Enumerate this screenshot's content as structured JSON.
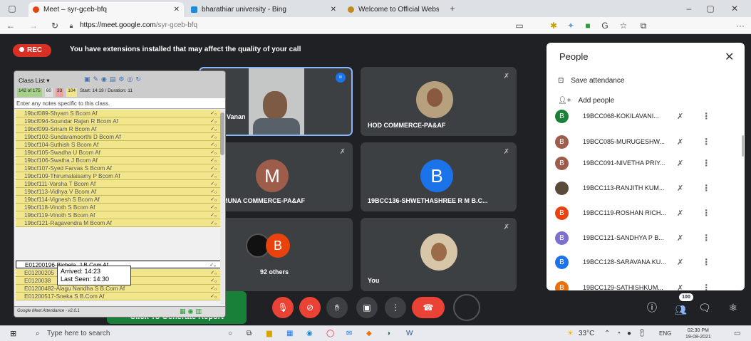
{
  "browser": {
    "tabs": [
      {
        "title": "Meet – syr-gceb-bfq"
      },
      {
        "title": "bharathiar university - Bing"
      },
      {
        "title": "Welcome to Official Website of"
      }
    ],
    "url_host": "https://meet.google.com",
    "url_path": "/syr-gceb-bfq"
  },
  "meet": {
    "rec_label": "REC",
    "warning": "You have extensions installed that may affect the quality of your call",
    "tiles": [
      {
        "name": "i Vanan"
      },
      {
        "name": "HOD COMMERCE-PA&AF"
      },
      {
        "name": "K. JAMUNA COMMERCE-PA&AF",
        "initial": "M"
      },
      {
        "name": "19BCC136-SHWETHASHREE R M B.C...",
        "initial": "B"
      },
      {
        "name": "92 others",
        "initial": "B"
      },
      {
        "name": "You"
      }
    ]
  },
  "people_panel": {
    "title": "People",
    "save_attendance": "Save attendance",
    "add_people": "Add people",
    "participants": [
      {
        "name": "19BCC068-KOKILAVANI...",
        "initial": "B",
        "color": "#188038"
      },
      {
        "name": "19BCC085-MURUGESHW...",
        "initial": "B",
        "color": "#9e5c4a"
      },
      {
        "name": "19BCC091-NIVETHA PRIY...",
        "initial": "B",
        "color": "#9e5c4a"
      },
      {
        "name": "19BCC113-RANJITH KUM...",
        "initial": "",
        "color": "#5a4a3a"
      },
      {
        "name": "19BCC119-ROSHAN RICH...",
        "initial": "B",
        "color": "#e8430f"
      },
      {
        "name": "19BCC121-SANDHYA P B...",
        "initial": "B",
        "color": "#7b6fd0"
      },
      {
        "name": "19BCC128-SARAVANA KU...",
        "initial": "B",
        "color": "#1a73e8"
      },
      {
        "name": "19BCC129-SATHISHKUM...",
        "initial": "B",
        "color": "#e8710a"
      }
    ],
    "count_badge": "100"
  },
  "class_list": {
    "title": "Class List",
    "stats": [
      "142 of 175",
      "60",
      "33",
      "104",
      "Start: 14:19 / Duration: 11"
    ],
    "note_placeholder": "Enter any notes specific to this class.",
    "rows": [
      "19bcf089-Shyam S Bcom Af",
      "19bcf094-Soundar Rajan R Bcom Af",
      "19bcf099-Sriram R Bcom Af",
      "19bcf102-Sundaramoorthi D Bcom Af",
      "19bcf104-Suthish S Bcom Af",
      "19bcf105-Swadha U Bcom Af",
      "19bcf106-Swatha J Bcom Af",
      "19bcf107-Syed Farvas S Bcom Af",
      "19bcf109-Thirumalaisamy P Bcom Af",
      "19bcf111-Varsha T Bcom Af",
      "19bcf113-Vidhya V Bcom Af",
      "19bcf114-Vignesh S Bcom Af",
      "19bcf118-Vinoth S Bcom Af",
      "19bcf119-Vinoth S Bcom Af",
      "19bcf121-Ragavendra M Bcom Af",
      "E01200196-Bichela. J B.Com Af",
      "E01200205",
      "E0120038",
      "E01200482-Alagu Nandha S B.Com Af",
      "E01200517-Sneka S B.Com Af"
    ],
    "tooltip_arrived": "Arrived: 14:23",
    "tooltip_lastseen": "Last Seen: 14:30",
    "footer": "Google Meet Attendance - v2.0.1",
    "generate_report": "Click To Generate Report"
  },
  "taskbar": {
    "search_placeholder": "Type here to search",
    "weather": "33°C",
    "lang": "ENG",
    "time": "02:30 PM",
    "date": "19-08-2021"
  }
}
